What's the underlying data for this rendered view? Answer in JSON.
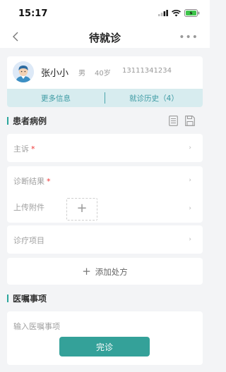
{
  "status_bar": {
    "time": "15:17"
  },
  "nav": {
    "title": "待就诊",
    "more": "•••"
  },
  "patient": {
    "name": "张小小",
    "gender": "男",
    "age": "40岁",
    "phone": "13111341234",
    "more_info": "更多信息",
    "history": "就诊历史（4）"
  },
  "case_section": {
    "title": "患者病例"
  },
  "fields": {
    "complaint": "主诉",
    "diagnosis": "诊断结果",
    "attachment": "上传附件",
    "treatment": "诊疗项目"
  },
  "add_prescription": "添加处方",
  "advice_section": {
    "title": "医嘱事项",
    "placeholder": "输入医嘱事项"
  },
  "finish_button": "完诊",
  "colors": {
    "accent": "#34a199",
    "tab_bg": "#d7ecef",
    "required": "#e33333"
  }
}
